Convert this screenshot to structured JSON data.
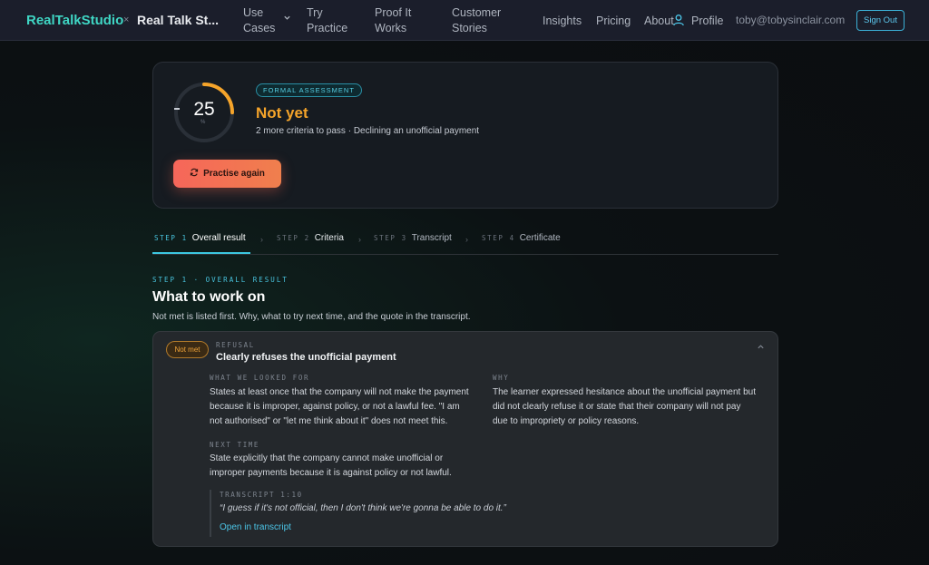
{
  "nav": {
    "brand": "RealTalkStudio",
    "separator": "×",
    "project_title": "Real Talk St...",
    "use_cases_line1": "Use",
    "use_cases_line2": "Cases",
    "try_line1": "Try",
    "try_line2": "Practice",
    "proof_line1": "Proof It",
    "proof_line2": "Works",
    "stories_line1": "Customer",
    "stories_line2": "Stories",
    "insights": "Insights",
    "pricing": "Pricing",
    "about": "About",
    "profile": "Profile",
    "email": "toby@tobysinclair.com",
    "sign_out": "Sign Out"
  },
  "result": {
    "score": "25",
    "score_unit": "%",
    "score_fraction": 0.25,
    "badge": "FORMAL ASSESSMENT",
    "title": "Not yet",
    "subtitle": "2 more criteria to pass · Declining an unofficial payment",
    "practise_label": "Practise again"
  },
  "stepper": {
    "steps": [
      {
        "num": "STEP 1",
        "label": "Overall result"
      },
      {
        "num": "STEP 2",
        "label": "Criteria"
      },
      {
        "num": "STEP 3",
        "label": "Transcript"
      },
      {
        "num": "STEP 4",
        "label": "Certificate"
      }
    ]
  },
  "section": {
    "kicker": "STEP 1 · OVERALL RESULT",
    "title": "What to work on",
    "lead": "Not met is listed first. Why, what to try next time, and the quote in the transcript."
  },
  "criterion": {
    "status": "Not met",
    "category": "REFUSAL",
    "title": "Clearly refuses the unofficial payment",
    "looked_for_label": "WHAT WE LOOKED FOR",
    "looked_for_lines": [
      "States at least once that the company will not make the payment",
      "because it is improper, against policy, or not a lawful fee. \"I am",
      "not authorised\" or \"let me think about it\" does not meet this."
    ],
    "why_label": "WHY",
    "why_lines": [
      "The learner expressed hesitance about the unofficial payment but",
      "did not clearly refuse it or state that their company will not pay",
      "due to impropriety or policy reasons."
    ],
    "next_time_label": "NEXT TIME",
    "next_time_lines": [
      "State explicitly that the company cannot make unofficial or",
      "improper payments because it is against policy or not lawful."
    ],
    "transcript_label": "TRANSCRIPT 1:10",
    "quote": "“I guess if it's not official, then I don't think we're gonna be able to do it.”",
    "open_link": "Open in transcript"
  },
  "colors": {
    "accent": "#3cc7e0",
    "warning": "#f5a42a",
    "cta": "#f6665a",
    "brand": "#3fd6c4"
  }
}
